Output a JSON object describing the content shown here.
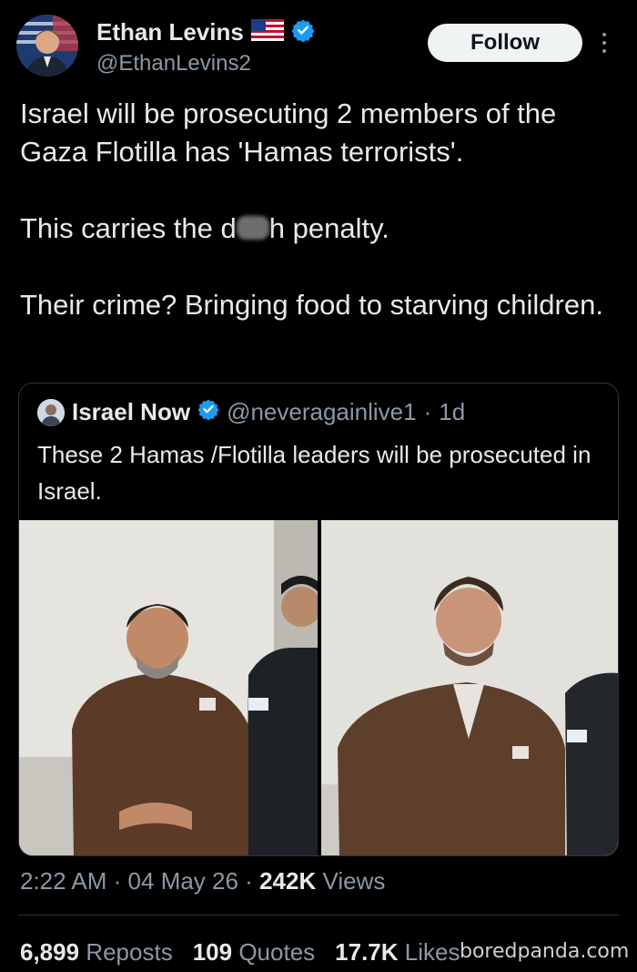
{
  "author": {
    "display_name": "Ethan Levins",
    "handle": "@EthanLevins2",
    "verified_color": "#1d9bf0",
    "flag_icon": "us-flag-icon"
  },
  "follow_label": "Follow",
  "tweet": {
    "line1": "Israel will be prosecuting 2 members of the Gaza Flotilla has 'Hamas terrorists'.",
    "line2_pre": "This carries the d",
    "line2_post": "h penalty.",
    "line3": "Their crime? Bringing food to starving children."
  },
  "quoted": {
    "display_name": "Israel Now",
    "handle": "@neveragainlive1",
    "sep": "·",
    "time": "1d",
    "text": "These 2 Hamas /Flotilla leaders will be prosecuted in Israel."
  },
  "meta": {
    "time": "2:22 AM",
    "sep1": "·",
    "date": "04 May 26",
    "sep2": "·",
    "views_count": "242K",
    "views_label": "Views"
  },
  "stats": {
    "reposts_count": "6,899",
    "reposts_label": "Reposts",
    "quotes_count": "109",
    "quotes_label": "Quotes",
    "likes_count": "17.7K",
    "likes_label": "Likes"
  },
  "watermark": "boredpanda.com",
  "colors": {
    "background": "#000000",
    "text": "#e7e9ea",
    "muted": "#8b98a5",
    "border": "#2f3336",
    "verified": "#1d9bf0"
  }
}
